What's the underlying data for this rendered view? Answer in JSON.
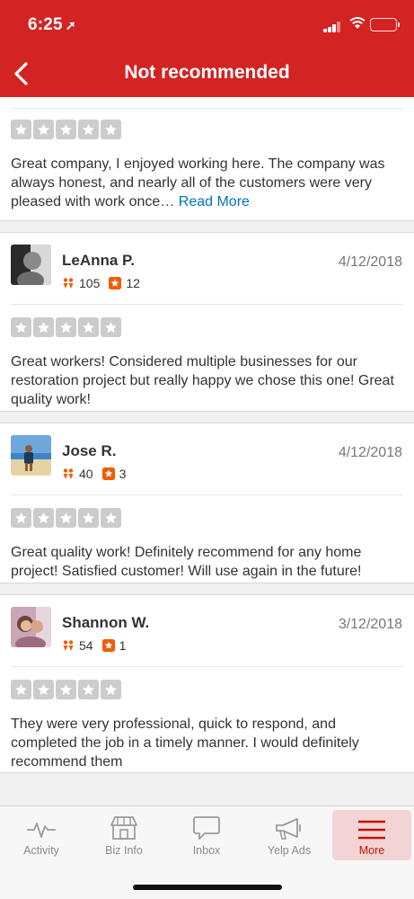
{
  "status_bar": {
    "time": "6:25",
    "location_arrow": "location-arrow-icon"
  },
  "nav": {
    "title": "Not recommended",
    "back": "chevron-left-icon"
  },
  "partial_review": {
    "text": "Great company, I enjoyed working here. The company was always honest, and nearly all of the customers were very pleased with work once…",
    "read_more": "Read More"
  },
  "reviews": [
    {
      "name": "LeAnna P.",
      "date": "4/12/2018",
      "friends": "105",
      "reviews_count": "12",
      "text": "Great workers! Considered multiple businesses for our restoration project but really happy we chose this one! Great quality work!"
    },
    {
      "name": "Jose R.",
      "date": "4/12/2018",
      "friends": "40",
      "reviews_count": "3",
      "text": "Great quality work! Definitely recommend for any home project! Satisfied customer! Will use again in the future!"
    },
    {
      "name": "Shannon W.",
      "date": "3/12/2018",
      "friends": "54",
      "reviews_count": "1",
      "text": "They were very professional, quick to respond, and completed the job in a timely manner. I would definitely recommend them"
    }
  ],
  "tabs": [
    {
      "label": "Activity",
      "icon": "activity-pulse-icon"
    },
    {
      "label": "Biz Info",
      "icon": "storefront-icon"
    },
    {
      "label": "Inbox",
      "icon": "chat-bubble-icon"
    },
    {
      "label": "Yelp Ads",
      "icon": "megaphone-icon"
    },
    {
      "label": "More",
      "icon": "hamburger-menu-icon",
      "active": true
    }
  ],
  "colors": {
    "brand_red": "#d32323",
    "star_gray": "#cccccc",
    "link_blue": "#0073bb",
    "friends_orange": "#f15c00",
    "active_tab_bg": "#f3d4d4"
  }
}
